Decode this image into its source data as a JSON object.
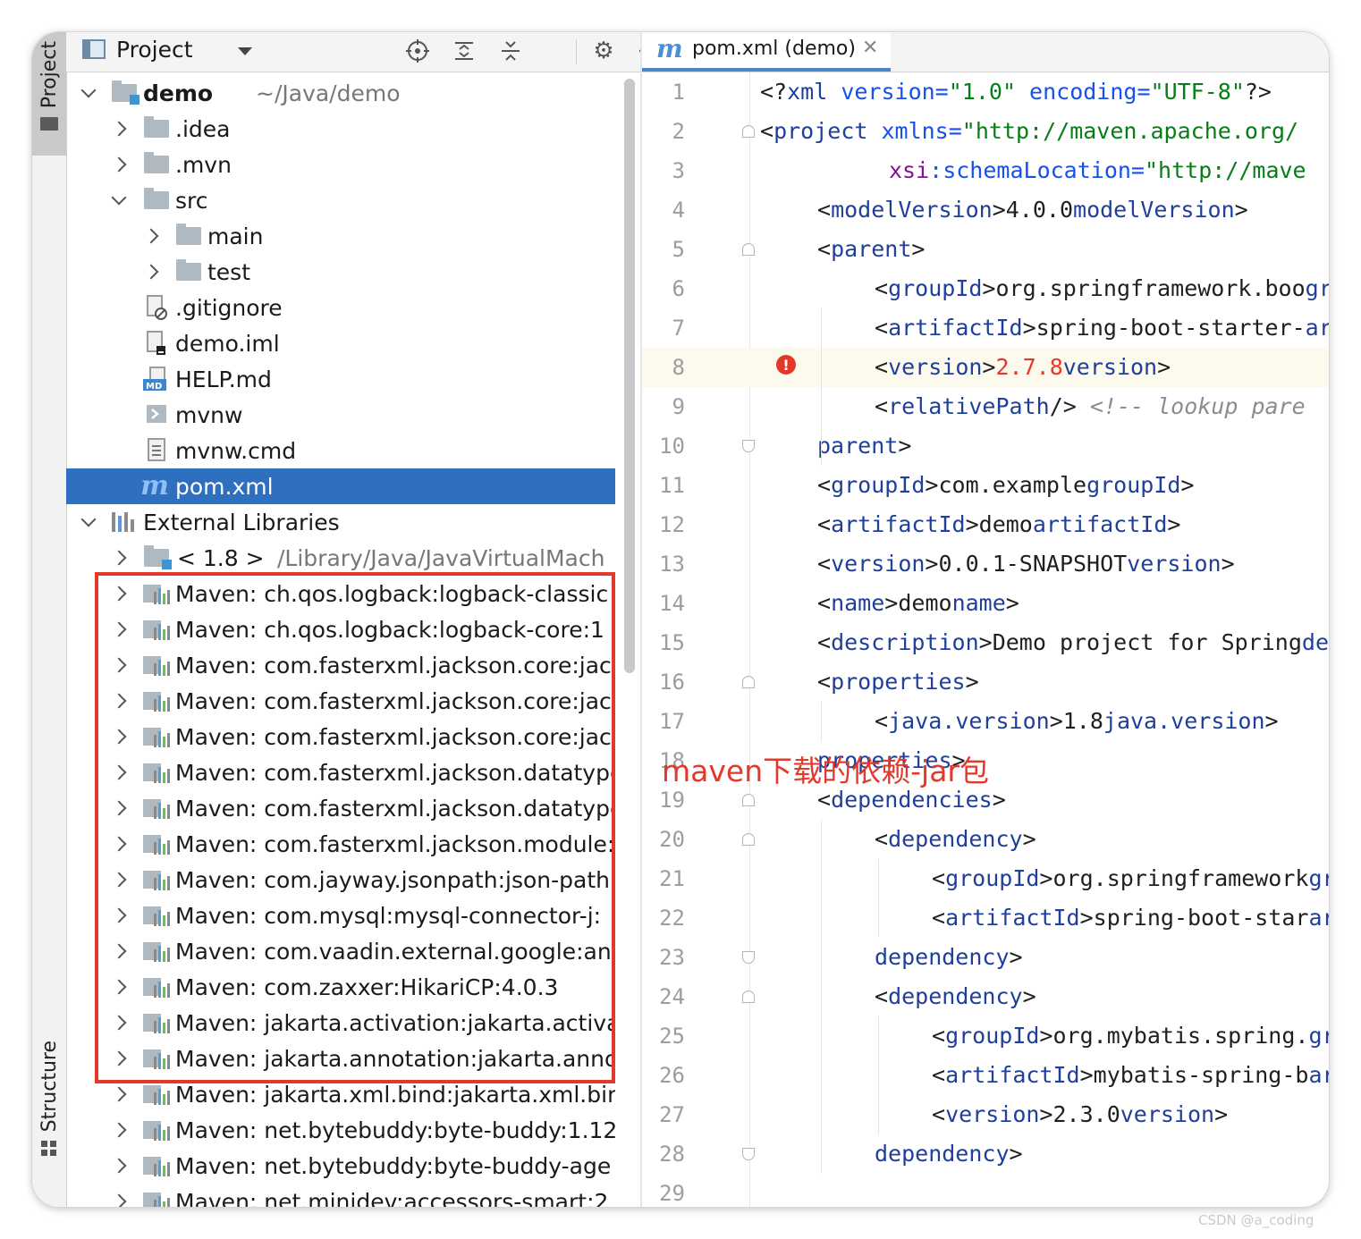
{
  "tool_window": {
    "project_tab": "Project",
    "structure_tab": "Structure"
  },
  "project_panel": {
    "title": "Project",
    "tree": {
      "root": {
        "name": "demo",
        "path": "~/Java/demo"
      },
      "idea": ".idea",
      "mvn": ".mvn",
      "src": "src",
      "main": "main",
      "test": "test",
      "gitignore": ".gitignore",
      "demo_iml": "demo.iml",
      "help_md": "HELP.md",
      "mvnw": "mvnw",
      "mvnw_cmd": "mvnw.cmd",
      "pom_xml": "pom.xml",
      "external_libraries": "External Libraries",
      "jdk": {
        "name": "< 1.8 >",
        "path": "/Library/Java/JavaVirtualMach"
      }
    },
    "libraries": [
      "Maven: ch.qos.logback:logback-classic",
      "Maven: ch.qos.logback:logback-core:1",
      "Maven: com.fasterxml.jackson.core:jac",
      "Maven: com.fasterxml.jackson.core:jac",
      "Maven: com.fasterxml.jackson.core:jac",
      "Maven: com.fasterxml.jackson.datatype",
      "Maven: com.fasterxml.jackson.datatype",
      "Maven: com.fasterxml.jackson.module:",
      "Maven: com.jayway.jsonpath:json-path",
      "Maven: com.mysql:mysql-connector-j:",
      "Maven: com.vaadin.external.google:and",
      "Maven: com.zaxxer:HikariCP:4.0.3",
      "Maven: jakarta.activation:jakarta.activa",
      "Maven: jakarta.annotation:jakarta.anno",
      "Maven: jakarta.xml.bind:jakarta.xml.bir",
      "Maven: net.bytebuddy:byte-buddy:1.12",
      "Maven: net.bytebuddy:byte-buddy-age",
      "Maven: net.minidev:accessors-smart:2"
    ]
  },
  "editor": {
    "tab_label": "pom.xml (demo)",
    "line_numbers": [
      "1",
      "2",
      "3",
      "4",
      "5",
      "6",
      "7",
      "8",
      "9",
      "10",
      "11",
      "12",
      "13",
      "14",
      "15",
      "16",
      "17",
      "18",
      "19",
      "20",
      "21",
      "22",
      "23",
      "24",
      "25",
      "26",
      "27",
      "28",
      "29"
    ],
    "code": {
      "l1": {
        "a": "<?",
        "b": "xml",
        "c": " version=",
        "d": "\"1.0\"",
        "e": " encoding=",
        "f": "\"UTF-8\"",
        "g": "?>"
      },
      "l2": {
        "a": "<",
        "b": "project",
        "c": " xmlns=",
        "d": "\"http://maven.apache.org/"
      },
      "l3": {
        "a": "xsi",
        "b": ":schemaLocation=",
        "c": "\"http://mave"
      },
      "l4": {
        "t": "modelVersion",
        "v": "4.0.0"
      },
      "l5": {
        "t": "parent"
      },
      "l6": {
        "t": "groupId",
        "v": "org.springframework.boo"
      },
      "l7": {
        "t": "artifactId",
        "v": "spring-boot-starter-"
      },
      "l8": {
        "t": "version",
        "v": "2.7.8"
      },
      "l9": {
        "t": "relativePath",
        "c": "<!-- lookup pare"
      },
      "l10": {
        "t": "parent"
      },
      "l11": {
        "t": "groupId",
        "v": "com.example"
      },
      "l12": {
        "t": "artifactId",
        "v": "demo"
      },
      "l13": {
        "t": "version",
        "v": "0.0.1-SNAPSHOT"
      },
      "l14": {
        "t": "name",
        "v": "demo"
      },
      "l15": {
        "t": "description",
        "v": "Demo project for Spring"
      },
      "l16": {
        "t": "properties"
      },
      "l17": {
        "t": "java.version",
        "v": "1.8"
      },
      "l18": {
        "t": "properties"
      },
      "l19": {
        "t": "dependencies"
      },
      "l20": {
        "t": "dependency"
      },
      "l21": {
        "t": "groupId",
        "v": "org.springframework"
      },
      "l22": {
        "t": "artifactId",
        "v": "spring-boot-star"
      },
      "l23": {
        "t": "dependency"
      },
      "l24": {
        "t": "dependency"
      },
      "l25": {
        "t": "groupId",
        "v": "org.mybatis.spring."
      },
      "l26": {
        "t": "artifactId",
        "v": "mybatis-spring-b"
      },
      "l27": {
        "t": "version",
        "v": "2.3.0"
      },
      "l28": {
        "t": "dependency"
      }
    }
  },
  "annotation": "maven下载的依赖-jar包",
  "watermark": "CSDN @a_coding",
  "colors": {
    "selection": "#2f6fbf",
    "annotation_red": "#e2392c",
    "xml_tag": "#1f3f9a",
    "xml_value": "#077d17"
  }
}
